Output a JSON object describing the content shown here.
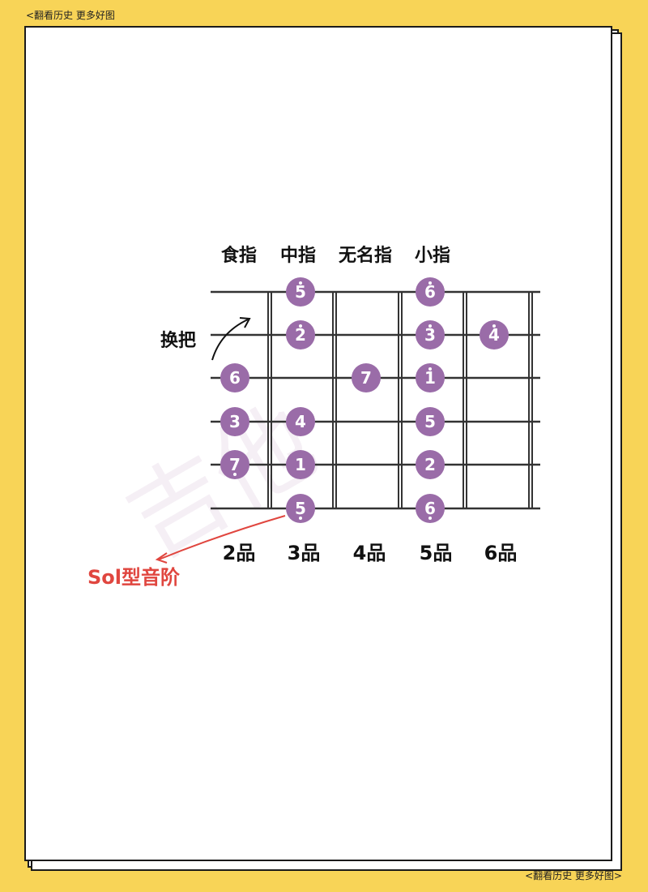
{
  "header": {
    "top_link": "<翻看历史  更多好图"
  },
  "footer": {
    "bottom_link": "<翻看历史  更多好图>"
  },
  "fingers": [
    "食指",
    "中指",
    "无名指",
    "小指"
  ],
  "frets": [
    "2品",
    "3品",
    "4品",
    "5品",
    "6品"
  ],
  "annotations": {
    "shift": "换把",
    "scale_name": "Sol型音阶"
  },
  "colors": {
    "note_fill": "#9A6CA8",
    "line": "#333333",
    "scale_label": "#E0463F",
    "background": "#F8D457"
  },
  "notes": [
    {
      "string": 1,
      "fret": 3,
      "label": "5",
      "dot": "high"
    },
    {
      "string": 1,
      "fret": 5,
      "label": "6",
      "dot": "high"
    },
    {
      "string": 2,
      "fret": 3,
      "label": "2",
      "dot": "high"
    },
    {
      "string": 2,
      "fret": 5,
      "label": "3",
      "dot": "high"
    },
    {
      "string": 2,
      "fret": 6,
      "label": "4",
      "dot": "high"
    },
    {
      "string": 3,
      "fret": 2,
      "label": "6",
      "dot": "none"
    },
    {
      "string": 3,
      "fret": 4,
      "label": "7",
      "dot": "none"
    },
    {
      "string": 3,
      "fret": 5,
      "label": "1",
      "dot": "high"
    },
    {
      "string": 4,
      "fret": 2,
      "label": "3",
      "dot": "none"
    },
    {
      "string": 4,
      "fret": 3,
      "label": "4",
      "dot": "none"
    },
    {
      "string": 4,
      "fret": 5,
      "label": "5",
      "dot": "none"
    },
    {
      "string": 5,
      "fret": 2,
      "label": "7",
      "dot": "low"
    },
    {
      "string": 5,
      "fret": 3,
      "label": "1",
      "dot": "none"
    },
    {
      "string": 5,
      "fret": 5,
      "label": "2",
      "dot": "none"
    },
    {
      "string": 6,
      "fret": 3,
      "label": "5",
      "dot": "low"
    },
    {
      "string": 6,
      "fret": 5,
      "label": "6",
      "dot": "low"
    }
  ]
}
